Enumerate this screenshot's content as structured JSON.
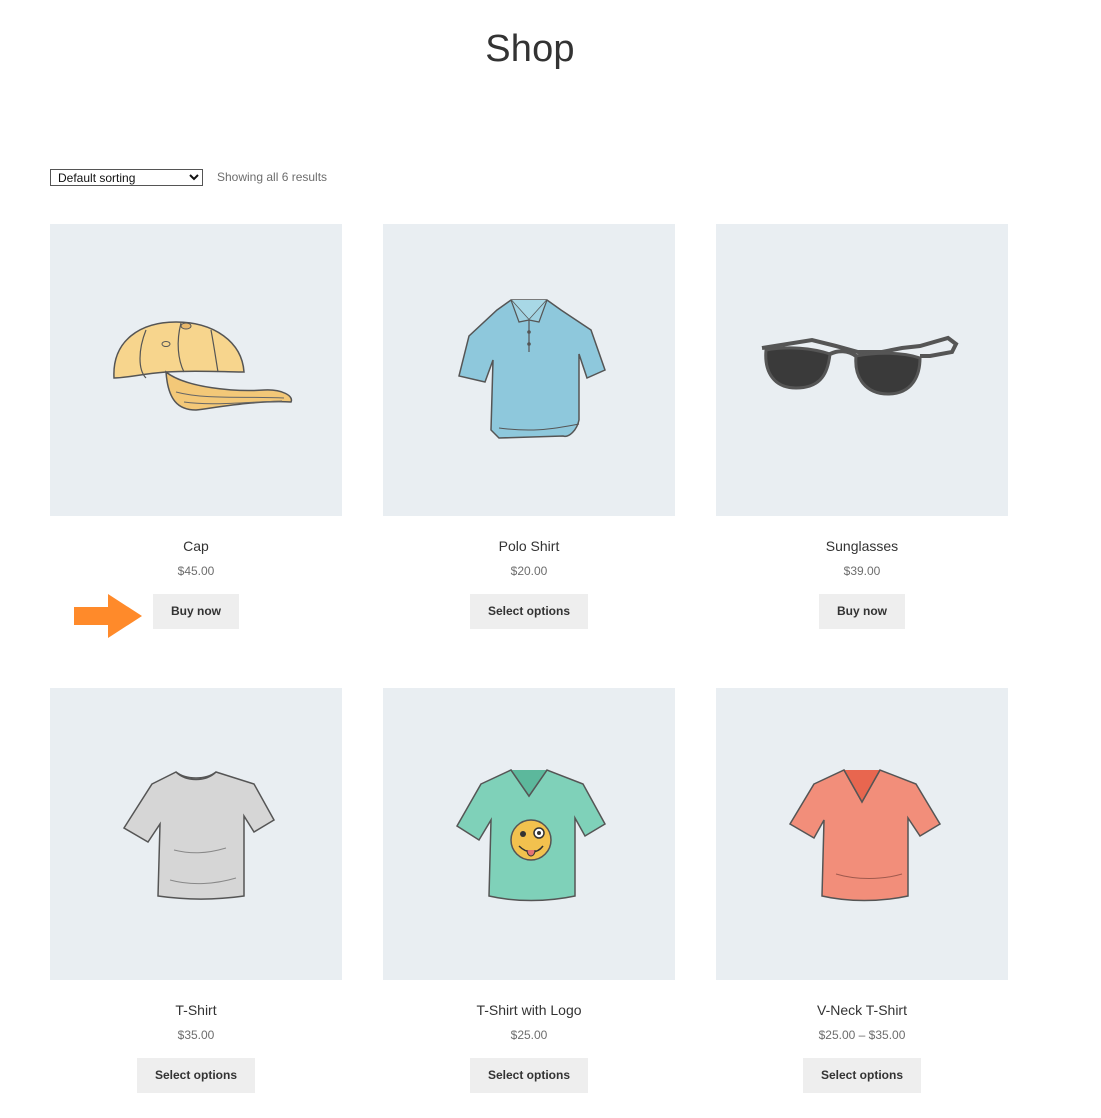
{
  "page": {
    "title": "Shop"
  },
  "toolbar": {
    "sort_selected": "Default sorting",
    "sort_options": [
      "Default sorting"
    ],
    "result_count": "Showing all 6 results"
  },
  "colors": {
    "thumb_bg": "#e9eef2",
    "button_bg": "#eeeeee",
    "arrow": "#ff8a2a"
  },
  "annotation": {
    "arrow_icon": "orange-arrow-right-icon"
  },
  "products": [
    {
      "name": "Cap",
      "price": "$45.00",
      "button": "Buy now",
      "icon": "cap-icon"
    },
    {
      "name": "Polo Shirt",
      "price": "$20.00",
      "button": "Select options",
      "icon": "polo-shirt-icon"
    },
    {
      "name": "Sunglasses",
      "price": "$39.00",
      "button": "Buy now",
      "icon": "sunglasses-icon"
    },
    {
      "name": "T-Shirt",
      "price": "$35.00",
      "button": "Select options",
      "icon": "tshirt-icon"
    },
    {
      "name": "T-Shirt with Logo",
      "price": "$25.00",
      "button": "Select options",
      "icon": "tshirt-logo-icon"
    },
    {
      "name": "V-Neck T-Shirt",
      "price": "$25.00 – $35.00",
      "button": "Select options",
      "icon": "vneck-tshirt-icon"
    }
  ]
}
